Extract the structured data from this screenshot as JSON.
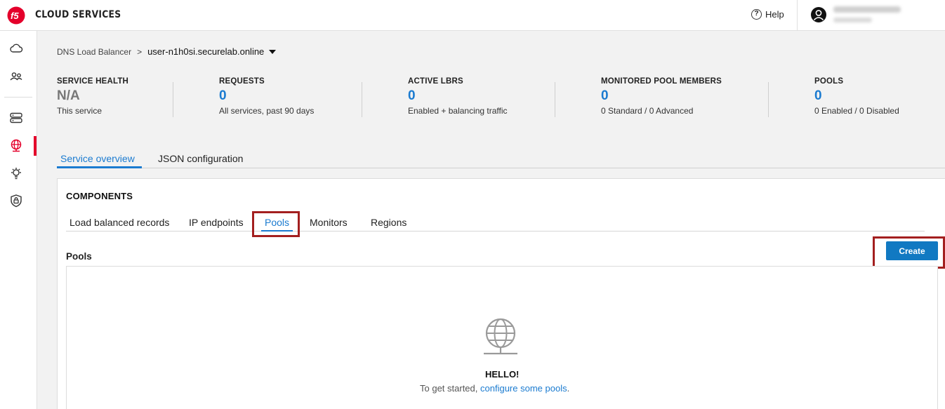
{
  "header": {
    "brand": "CLOUD SERVICES",
    "help_label": "Help",
    "help_icon": "?",
    "brand_color": "#e4002b"
  },
  "sidebar": {
    "items": [
      {
        "icon": "cloud-icon"
      },
      {
        "icon": "users-icon"
      },
      {
        "icon": "server-icon"
      },
      {
        "icon": "globe-icon",
        "active": true
      },
      {
        "icon": "lightbulb-gear-icon"
      },
      {
        "icon": "shield-lock-icon"
      }
    ]
  },
  "breadcrumb": {
    "parent": "DNS Load Balancer",
    "separator": ">",
    "current": "user-n1h0si.securelab.online"
  },
  "stats": [
    {
      "label": "SERVICE HEALTH",
      "value": "N/A",
      "sub": "This service"
    },
    {
      "label": "REQUESTS",
      "value": "0",
      "sub": "All services, past 90 days"
    },
    {
      "label": "ACTIVE LBRS",
      "value": "0",
      "sub": "Enabled + balancing traffic"
    },
    {
      "label": "MONITORED POOL MEMBERS",
      "value": "0",
      "sub": "0 Standard / 0 Advanced"
    },
    {
      "label": "POOLS",
      "value": "0",
      "sub": "0 Enabled / 0 Disabled"
    }
  ],
  "main_tabs": [
    {
      "label": "Service overview",
      "active": true
    },
    {
      "label": "JSON configuration",
      "active": false
    }
  ],
  "components": {
    "title": "COMPONENTS",
    "tabs": [
      {
        "label": "Load balanced records"
      },
      {
        "label": "IP endpoints"
      },
      {
        "label": "Pools",
        "active": true
      },
      {
        "label": "Monitors"
      },
      {
        "label": "Regions"
      }
    ],
    "section_label": "Pools",
    "create_label": "Create",
    "empty_title": "HELLO!",
    "empty_text": "To get started,",
    "empty_link": "configure some pools",
    "empty_end": "."
  },
  "colors": {
    "accent": "#1b7bd0",
    "button": "#1179c2",
    "highlight": "#a31f1f"
  }
}
